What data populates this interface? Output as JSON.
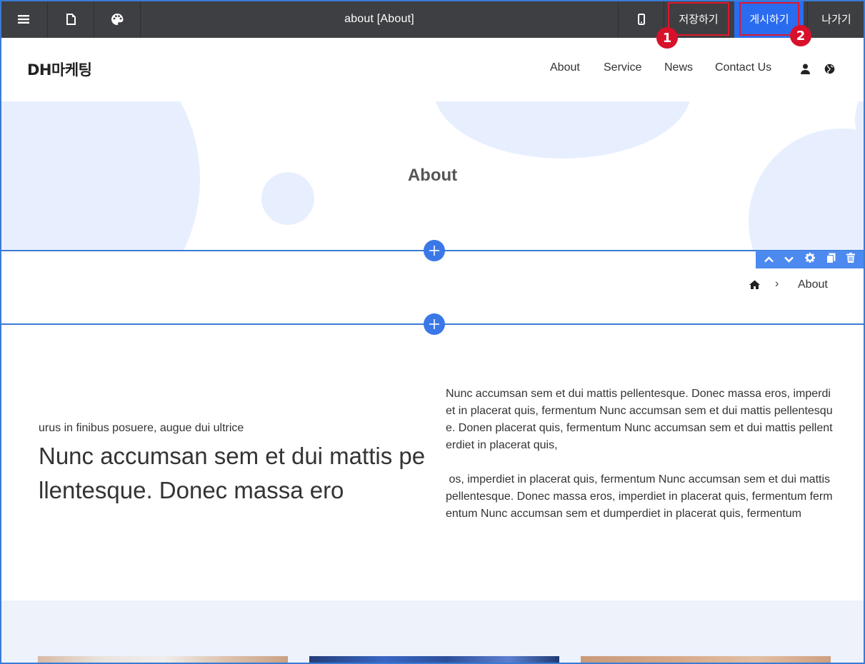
{
  "toolbar": {
    "menu_icon": "hamburger-menu-icon",
    "page_icon": "document-icon",
    "theme_icon": "palette-icon",
    "page_title": "about [About]",
    "mobile_icon": "mobile-icon",
    "save_label": "저장하기",
    "publish_label": "게시하기",
    "exit_label": "나가기",
    "annotations": [
      "1",
      "2"
    ],
    "annotation_color": "#d8102a",
    "publish_color": "#2a6cf0"
  },
  "site": {
    "logo": "DH마케팅",
    "nav": [
      "About",
      "Service",
      "News",
      "Contact Us"
    ],
    "user_icon": "user-icon",
    "globe_icon": "globe-icon"
  },
  "hero": {
    "title": "About",
    "accent": "#e7efff"
  },
  "section_tools": [
    "chevron-up-icon",
    "chevron-down-icon",
    "gear-icon",
    "copy-icon",
    "trash-icon"
  ],
  "breadcrumb": {
    "home_icon": "home-icon",
    "separator": "›",
    "current": "About"
  },
  "content": {
    "eyebrow": "urus in finibus posuere, augue dui ultrice",
    "heading": "Nunc accumsan sem et dui mattis pellentesque. Donec massa ero",
    "paragraph1": "Nunc accumsan sem et dui mattis pellentesque. Donec massa eros, imperdiet in placerat quis, fermentum Nunc accumsan sem et dui mattis pellentesque. Donen placerat quis, fermentum Nunc accumsan sem et dui mattis pellenterdiet in placerat quis,",
    "paragraph2": " os, imperdiet in placerat quis, fermentum Nunc accumsan sem et dui mattis pellentesque. Donec massa eros, imperdiet in placerat quis, fermentum fermentum Nunc accumsan sem et dumperdiet in placerat quis, fermentum"
  }
}
